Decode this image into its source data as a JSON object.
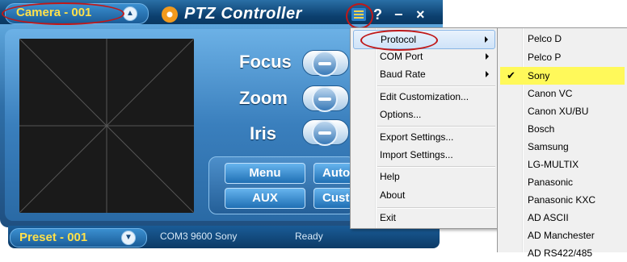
{
  "window": {
    "camera_label": "Camera - 001",
    "app_title": "PTZ Controller",
    "help_label": "?",
    "minimize_label": "−",
    "close_label": "×"
  },
  "controls": {
    "focus_label": "Focus",
    "zoom_label": "Zoom",
    "iris_label": "Iris"
  },
  "buttons": {
    "menu_label": "Menu",
    "auto_label": "Auto",
    "aux_label": "AUX",
    "custom_label": "Cust"
  },
  "status": {
    "preset_label": "Preset - 001",
    "connection": "COM3 9600 Sony",
    "state": "Ready"
  },
  "menu": {
    "items": [
      {
        "label": "Protocol",
        "submenu": true,
        "active": true
      },
      {
        "label": "COM Port",
        "submenu": true
      },
      {
        "label": "Baud Rate",
        "submenu": true
      },
      {
        "label": "Edit Customization..."
      },
      {
        "label": "Options..."
      },
      {
        "label": "Export Settings..."
      },
      {
        "label": "Import Settings..."
      },
      {
        "label": "Help"
      },
      {
        "label": "About"
      },
      {
        "label": "Exit"
      }
    ]
  },
  "protocol_submenu": {
    "items": [
      {
        "label": "Pelco D"
      },
      {
        "label": "Pelco P"
      },
      {
        "label": "Sony",
        "checked": true
      },
      {
        "label": "Canon VC"
      },
      {
        "label": "Canon XU/BU"
      },
      {
        "label": "Bosch"
      },
      {
        "label": "Samsung"
      },
      {
        "label": "LG-MULTIX"
      },
      {
        "label": "Panasonic"
      },
      {
        "label": "Panasonic KXC"
      },
      {
        "label": "AD ASCII"
      },
      {
        "label": "AD Manchester"
      },
      {
        "label": "AD RS422/485"
      }
    ]
  },
  "colors": {
    "accent_yellow": "#ffe14a",
    "highlight_circle": "#c01818",
    "checked_highlight": "#fff95a"
  }
}
